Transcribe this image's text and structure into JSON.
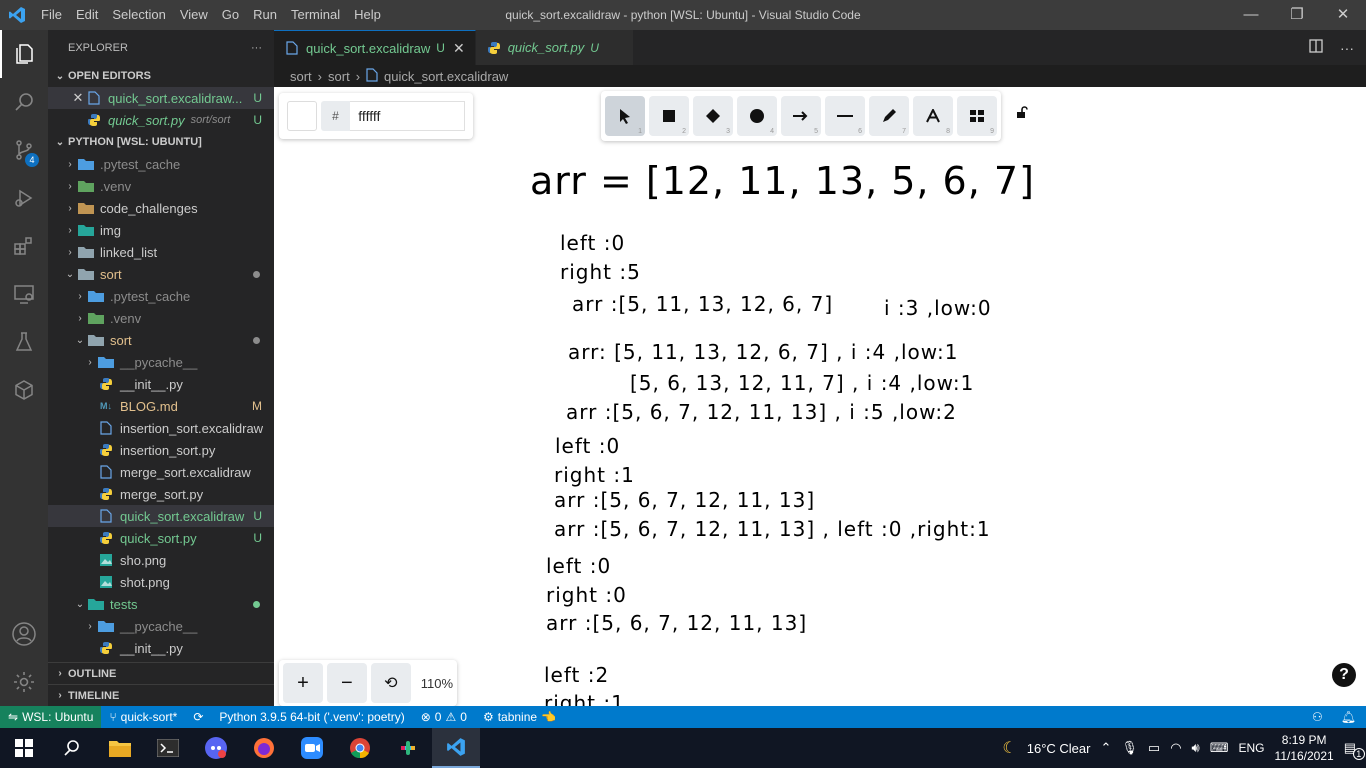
{
  "window": {
    "title": "quick_sort.excalidraw - python [WSL: Ubuntu] - Visual Studio Code",
    "menu": [
      "File",
      "Edit",
      "Selection",
      "View",
      "Go",
      "Run",
      "Terminal",
      "Help"
    ],
    "controls": [
      "—",
      "❐",
      "✕"
    ]
  },
  "activity_bar": {
    "scm_badge": "4"
  },
  "explorer": {
    "header": "EXPLORER",
    "more": "···",
    "open_editors_title": "OPEN EDITORS",
    "open_editors": [
      {
        "close": "✕",
        "name": "quick_sort.excalidraw...",
        "status": "U"
      },
      {
        "name": "quick_sort.py",
        "path": "sort/sort",
        "status": "U"
      }
    ],
    "workspace_title": "PYTHON [WSL: UBUNTU]",
    "tree": [
      {
        "name": ".pytest_cache"
      },
      {
        "name": ".venv"
      },
      {
        "name": "code_challenges"
      },
      {
        "name": "img"
      },
      {
        "name": "linked_list"
      },
      {
        "name": "sort"
      },
      {
        "name": ".pytest_cache"
      },
      {
        "name": ".venv"
      },
      {
        "name": "sort"
      },
      {
        "name": "__pycache__"
      },
      {
        "name": "__init__.py"
      },
      {
        "name": "BLOG.md",
        "status": "M"
      },
      {
        "name": "insertion_sort.excalidraw"
      },
      {
        "name": "insertion_sort.py"
      },
      {
        "name": "merge_sort.excalidraw"
      },
      {
        "name": "merge_sort.py"
      },
      {
        "name": "quick_sort.excalidraw",
        "status": "U"
      },
      {
        "name": "quick_sort.py",
        "status": "U"
      },
      {
        "name": "sho.png"
      },
      {
        "name": "shot.png"
      },
      {
        "name": "tests"
      },
      {
        "name": "__pycache__"
      },
      {
        "name": "__init__.py"
      }
    ],
    "outline_title": "OUTLINE",
    "timeline_title": "TIMELINE"
  },
  "tabs": [
    {
      "label": "quick_sort.excalidraw",
      "status": "U",
      "close": "✕"
    },
    {
      "label": "quick_sort.py",
      "status": "U"
    }
  ],
  "breadcrumb": [
    "sort",
    "sort",
    "quick_sort.excalidraw"
  ],
  "excalidraw": {
    "color_hash": "#",
    "color_value": "ffffff",
    "tool_numbers": [
      "1",
      "2",
      "3",
      "4",
      "5",
      "6",
      "7",
      "8",
      "9"
    ],
    "zoom_level": "110%",
    "help": "?",
    "zoom_in": "+",
    "zoom_out": "−",
    "zoom_reset": "⟲",
    "lines": [
      "arr = [12, 11, 13, 5, 6, 7]",
      "left :0",
      "right :5",
      "arr :[5, 11, 13, 12, 6, 7]",
      "i :3 ,low:0",
      "arr: [5, 11, 13, 12, 6, 7] , i :4 ,low:1",
      "[5, 6, 13, 12, 11, 7] , i :4 ,low:1",
      "arr :[5, 6, 7, 12, 11, 13] , i :5 ,low:2",
      "left :0",
      "right :1",
      "arr :[5, 6, 7, 12, 11, 13]",
      "arr :[5, 6, 7, 12, 11, 13] , left :0 ,right:1",
      "left :0",
      "right :0",
      "arr :[5, 6, 7, 12, 11, 13]",
      "left :2",
      "right :1"
    ]
  },
  "statusbar": {
    "remote": "WSL: Ubuntu",
    "branch": "quick-sort*",
    "python": "Python 3.9.5 64-bit ('.venv': poetry)",
    "errors": "0",
    "warnings": "0",
    "tabnine": "tabnine"
  },
  "taskbar": {
    "weather": "16°C  Clear",
    "lang": "ENG",
    "time": "8:19 PM",
    "date": "11/16/2021",
    "notif": "1"
  }
}
